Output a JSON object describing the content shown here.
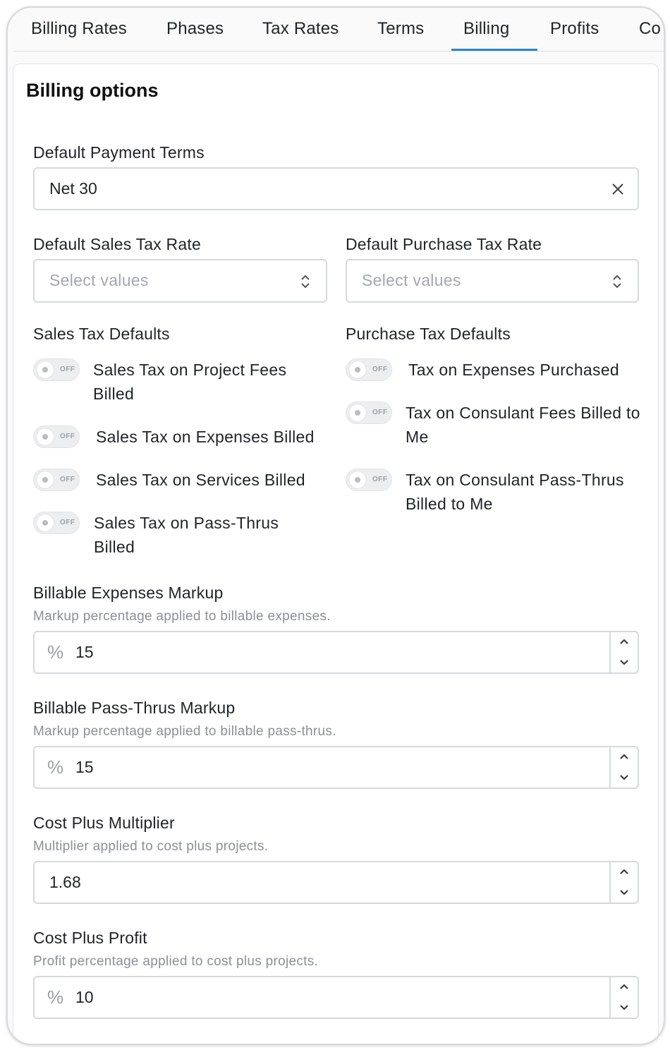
{
  "tabs": [
    {
      "label": "Billing Rates"
    },
    {
      "label": "Phases"
    },
    {
      "label": "Tax Rates"
    },
    {
      "label": "Terms"
    },
    {
      "label": "Billing",
      "active": true
    },
    {
      "label": "Profits"
    },
    {
      "label": "Co"
    }
  ],
  "card": {
    "title": "Billing options"
  },
  "payment_terms": {
    "label": "Default Payment Terms",
    "value": "Net 30",
    "clear_icon": "close-icon"
  },
  "sales_tax_rate": {
    "label": "Default Sales Tax Rate",
    "placeholder": "Select values"
  },
  "purchase_tax_rate": {
    "label": "Default Purchase Tax Rate",
    "placeholder": "Select values"
  },
  "sales_tax_defaults": {
    "heading": "Sales Tax Defaults",
    "items": [
      {
        "label": "Sales Tax on Project Fees Billed",
        "state": "OFF"
      },
      {
        "label": "Sales Tax on Expenses Billed",
        "state": "OFF"
      },
      {
        "label": "Sales Tax on Services Billed",
        "state": "OFF"
      },
      {
        "label": "Sales Tax on Pass-Thrus Billed",
        "state": "OFF"
      }
    ]
  },
  "purchase_tax_defaults": {
    "heading": "Purchase Tax Defaults",
    "items": [
      {
        "label": "Tax on Expenses Purchased",
        "state": "OFF"
      },
      {
        "label": "Tax on Consulant Fees Billed to Me",
        "state": "OFF"
      },
      {
        "label": "Tax on Consulant Pass-Thrus Billed to Me",
        "state": "OFF"
      }
    ]
  },
  "expenses_markup": {
    "label": "Billable Expenses Markup",
    "help": "Markup percentage applied to billable expenses.",
    "prefix": "%",
    "value": "15"
  },
  "passthru_markup": {
    "label": "Billable Pass-Thrus Markup",
    "help": "Markup percentage applied to billable pass-thrus.",
    "prefix": "%",
    "value": "15"
  },
  "cost_plus_multiplier": {
    "label": "Cost Plus Multiplier",
    "help": "Multiplier applied to cost plus projects.",
    "value": "1.68"
  },
  "cost_plus_profit": {
    "label": "Cost Plus Profit",
    "help": "Profit percentage applied to cost plus projects.",
    "prefix": "%",
    "value": "10"
  },
  "colors": {
    "accent": "#2e86c1",
    "border": "#d5d9de",
    "muted": "#8b9097"
  }
}
